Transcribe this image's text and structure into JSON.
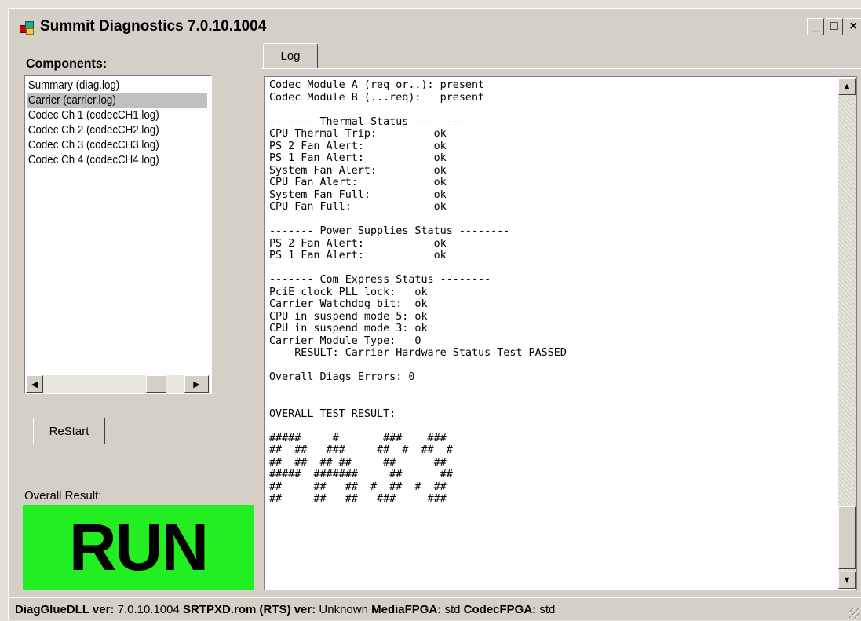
{
  "window": {
    "title": "Summit Diagnostics 7.0.10.1004",
    "controls": {
      "minimize": "_",
      "maximize": "□",
      "close": "×"
    }
  },
  "left_panel": {
    "components_label": "Components:",
    "components": [
      "Summary (diag.log)",
      "Carrier (carrier.log)",
      "Codec Ch 1 (codecCH1.log)",
      "Codec Ch 2 (codecCH2.log)",
      "Codec Ch 3 (codecCH3.log)",
      "Codec Ch 4 (codecCH4.log)"
    ],
    "selected_component": "Carrier (carrier.log)",
    "restart_button": "ReStart",
    "overall_result_label": "Overall Result:",
    "overall_result_value": "RUN",
    "result_color": "#22ee22"
  },
  "log_panel": {
    "tab_label": "Log",
    "lines": [
      "Codec Module A (req or..): present",
      "Codec Module B (...req):   present",
      "",
      "------- Thermal Status --------",
      "CPU Thermal Trip:         ok",
      "PS 2 Fan Alert:           ok",
      "PS 1 Fan Alert:           ok",
      "System Fan Alert:         ok",
      "CPU Fan Alert:            ok",
      "System Fan Full:          ok",
      "CPU Fan Full:             ok",
      "",
      "------- Power Supplies Status --------",
      "PS 2 Fan Alert:           ok",
      "PS 1 Fan Alert:           ok",
      "",
      "------- Com Express Status --------",
      "PciE clock PLL lock:   ok",
      "Carrier Watchdog bit:  ok",
      "CPU in suspend mode 5: ok",
      "CPU in suspend mode 3: ok",
      "Carrier Module Type:   0",
      "    RESULT: Carrier Hardware Status Test PASSED",
      "",
      "Overall Diags Errors: 0",
      "",
      "",
      "OVERALL TEST RESULT:",
      "",
      "#####     #       ###    ###",
      "##  ##   ###     ##  #  ##  #",
      "##  ##  ## ##     ##      ##",
      "#####  #######     ##      ##",
      "##     ##   ##  #  ##  #  ##",
      "##     ##   ##   ###     ###"
    ]
  },
  "status_bar": {
    "diagglue_label": "DiagGlueDLL ver:",
    "diagglue_value": "7.0.10.1004",
    "srtpxd_label": "SRTPXD.rom (RTS) ver:",
    "srtpxd_value": "Unknown",
    "mediafpga_label": "MediaFPGA:",
    "mediafpga_value": "std",
    "codecfpga_label": "CodecFPGA:",
    "codecfpga_value": "std"
  }
}
